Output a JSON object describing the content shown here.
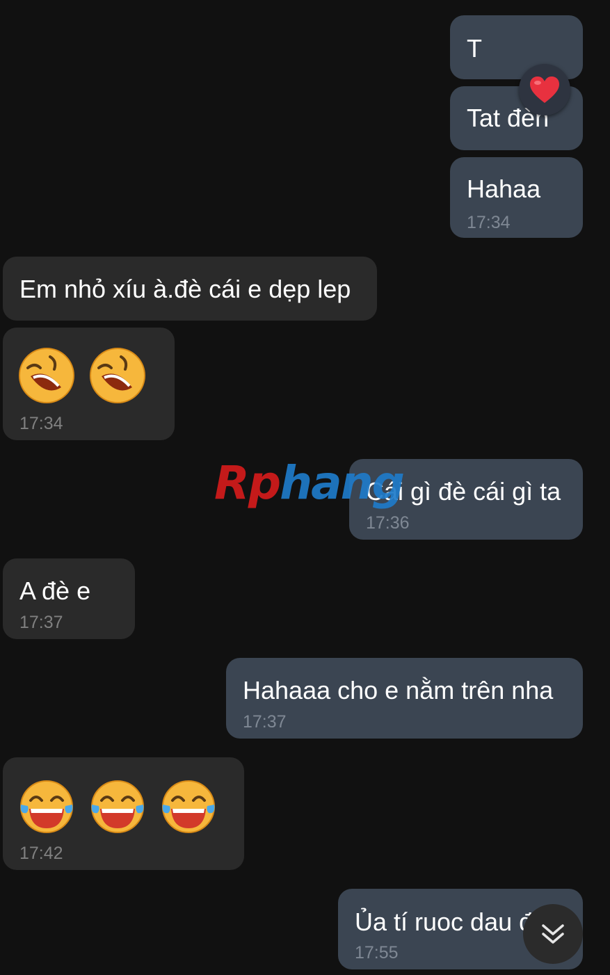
{
  "watermark": {
    "part1": "Rp",
    "part2": "hang"
  },
  "messages": [
    {
      "dir": "out",
      "text": "T"
    },
    {
      "dir": "out",
      "text": "Tat đèn",
      "reaction": "heart-icon"
    },
    {
      "dir": "out",
      "text": "Hahaa",
      "time": "17:34"
    },
    {
      "dir": "in",
      "text": "Em nhỏ xíu à.đè cái e dẹp lep"
    },
    {
      "dir": "in",
      "emoji": [
        "laughing-face-icon",
        "laughing-face-icon"
      ],
      "time": "17:34"
    },
    {
      "dir": "out",
      "text": "Cái gì đè cái gì ta",
      "time": "17:36"
    },
    {
      "dir": "in",
      "text": "A đè e",
      "time": "17:37"
    },
    {
      "dir": "out",
      "text": "Hahaaa cho e nằm trên nha",
      "time": "17:37"
    },
    {
      "dir": "in",
      "emoji": [
        "tears-of-joy-face-icon",
        "tears-of-joy-face-icon",
        "tears-of-joy-face-icon"
      ],
      "time": "17:42"
    },
    {
      "dir": "out",
      "text": "Ủa tí ruoc dau đ",
      "time": "17:55"
    }
  ],
  "icons": {
    "reaction": "heart-icon",
    "scroll": "double-chevron-down-icon"
  },
  "colors": {
    "background": "#111111",
    "outgoing_bubble": "#3b4552",
    "incoming_bubble": "#2a2a2a",
    "heart": "#e8313f"
  }
}
